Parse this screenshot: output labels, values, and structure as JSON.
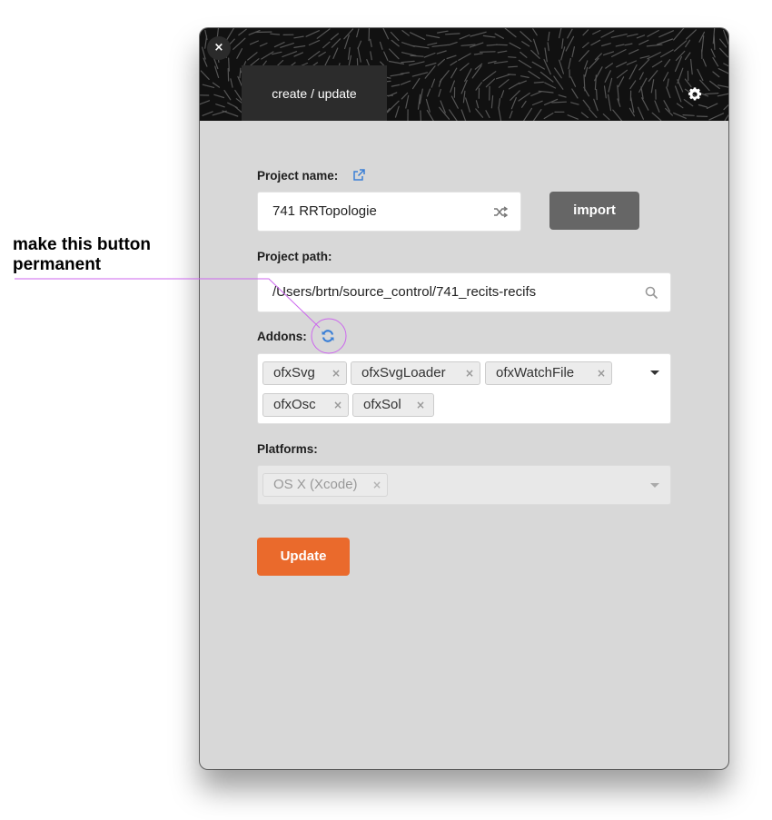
{
  "header": {
    "tab_label": "create / update",
    "close_label": "×"
  },
  "form": {
    "project_name_label": "Project name:",
    "project_name_value": "741 RRTopologie",
    "import_label": "import",
    "project_path_label": "Project path:",
    "project_path_value": "/Users/brtn/source_control/741_recits-recifs",
    "addons_label": "Addons:",
    "addons": [
      "ofxSvg",
      "ofxSvgLoader",
      "ofxWatchFile",
      "ofxOsc",
      "ofxSol"
    ],
    "platforms_label": "Platforms:",
    "platforms": [
      "OS X (Xcode)"
    ],
    "update_label": "Update"
  },
  "annotation": {
    "text": "make this button permanent",
    "color": "#cc66ee"
  },
  "colors": {
    "accent": "#ea6a2c",
    "link_icon": "#3a7fd6",
    "button_gray": "#666666"
  },
  "icons": {
    "external_link": "external-link-icon",
    "shuffle": "shuffle-icon",
    "search": "search-icon",
    "refresh": "refresh-icon",
    "settings": "gear-icon"
  }
}
